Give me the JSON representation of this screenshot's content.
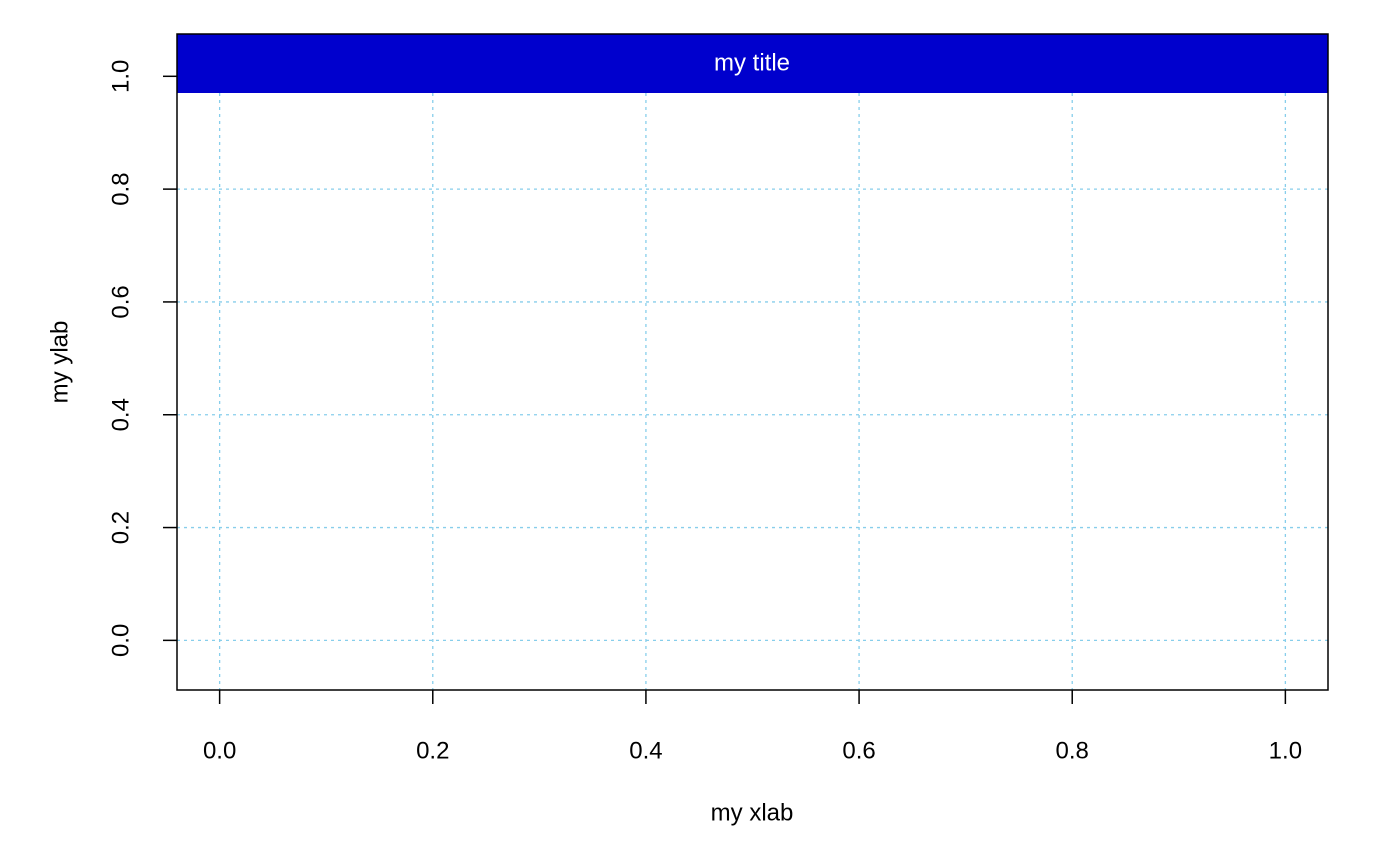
{
  "chart_data": {
    "type": "scatter",
    "title": "my title",
    "xlabel": "my xlab",
    "ylabel": "my ylab",
    "xlim": [
      -0.04,
      1.04
    ],
    "ylim": [
      -0.088,
      1.075
    ],
    "x_ticks": [
      0.0,
      0.2,
      0.4,
      0.6,
      0.8,
      1.0
    ],
    "x_tick_labels": [
      "0.0",
      "0.2",
      "0.4",
      "0.6",
      "0.8",
      "1.0"
    ],
    "y_ticks": [
      0.0,
      0.2,
      0.4,
      0.6,
      0.8,
      1.0
    ],
    "y_tick_labels": [
      "0.0",
      "0.2",
      "0.4",
      "0.6",
      "0.8",
      "1.0"
    ],
    "grid": true,
    "series": [],
    "colors": {
      "title_band": "#0000CD",
      "title_text": "#ffffff",
      "grid": "#87CEEB",
      "axis": "#000000"
    }
  }
}
